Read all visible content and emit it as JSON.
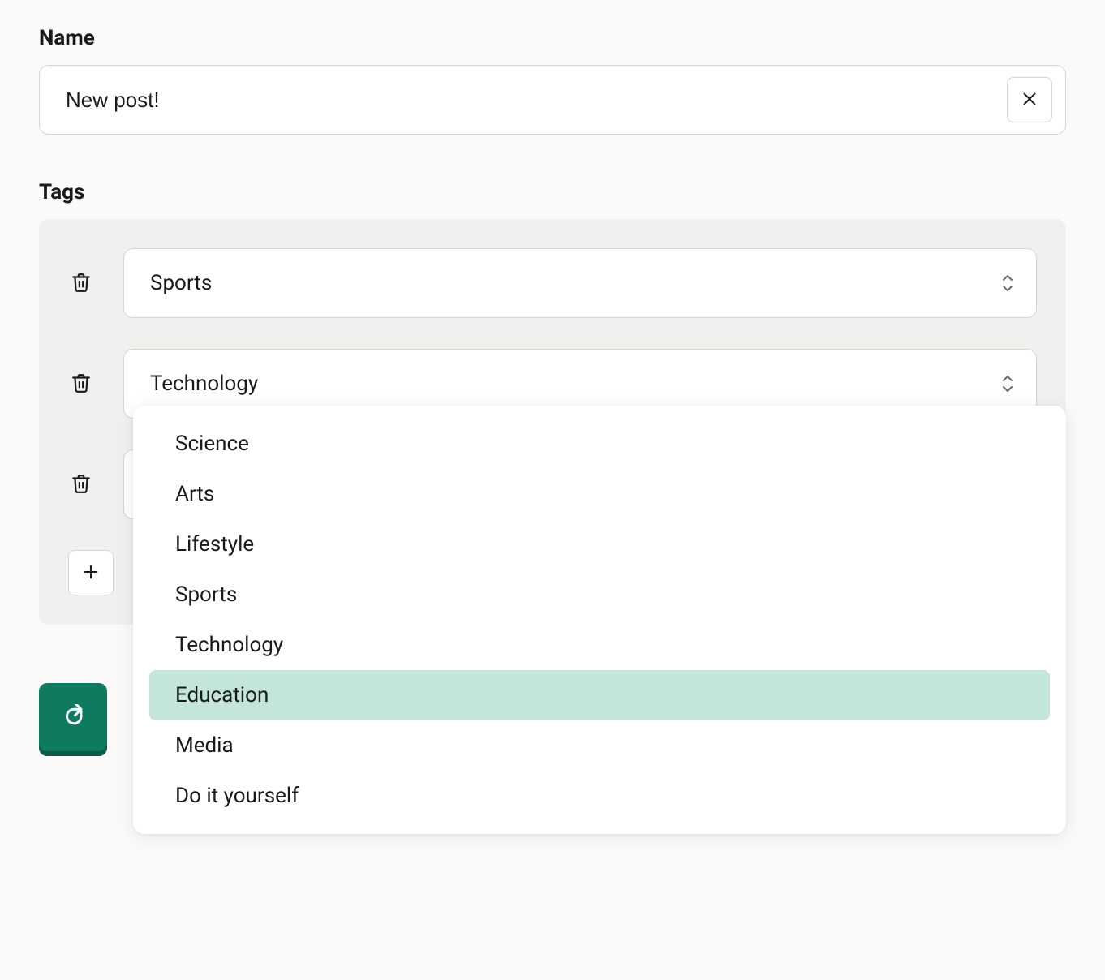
{
  "name_field": {
    "label": "Name",
    "value": "New post!"
  },
  "tags_field": {
    "label": "Tags",
    "rows": [
      {
        "value": "Sports"
      },
      {
        "value": "Technology"
      },
      {
        "value": ""
      }
    ],
    "dropdown": {
      "options": [
        "Science",
        "Arts",
        "Lifestyle",
        "Sports",
        "Technology",
        "Education",
        "Media",
        "Do it yourself"
      ],
      "highlighted": "Education"
    }
  },
  "icons": {
    "clear": "close-icon",
    "trash": "trash-icon",
    "caret": "chevron-updown-icon",
    "add": "plus-icon",
    "submit": "redo-icon"
  },
  "colors": {
    "accent": "#0e7a5f",
    "highlight": "#c3e6d9",
    "panel": "#f1f0ee",
    "bg": "#fbfaf8"
  }
}
